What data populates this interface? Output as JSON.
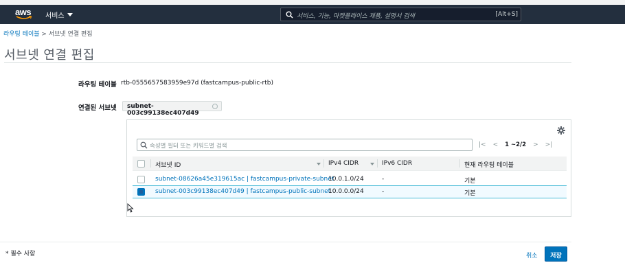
{
  "header": {
    "logo_text": "aws",
    "services_label": "서비스",
    "search_placeholder": "서비스, 기능, 마켓플레이스 제품, 설명서 검색",
    "search_shortcut": "[Alt+S]"
  },
  "breadcrumb": {
    "parent": "라우팅 테이블",
    "separator": ">",
    "current": "서브넷 연결 편집"
  },
  "page_title": "서브넷 연결 편집",
  "form": {
    "route_table_label": "라우팅 테이블",
    "route_table_value": "rtb-0555657583959e97d (fastcampus-public-rtb)",
    "associated_label": "연결된 서브넷",
    "associated_chip": "subnet-003c99138ec407d49"
  },
  "table": {
    "filter_placeholder": "속성별 필터 또는 키워드별 검색",
    "pagination": "1 ~2/2",
    "columns": [
      "서브넷 ID",
      "IPv4 CIDR",
      "IPv6 CIDR",
      "현재 라우팅 테이블"
    ],
    "rows": [
      {
        "subnet": "subnet-08626a45e319615ac | fastcampus-private-subnet",
        "ipv4": "10.0.1.0/24",
        "ipv6": "-",
        "route_table": "기본",
        "selected": false
      },
      {
        "subnet": "subnet-003c99138ec407d49 | fastcampus-public-subnet",
        "ipv4": "10.0.0.0/24",
        "ipv6": "-",
        "route_table": "기본",
        "selected": true
      }
    ]
  },
  "footer": {
    "required_note": "* 필수 사항",
    "cancel_label": "취소",
    "save_label": "저장"
  },
  "colors": {
    "topbar": "#232f3e",
    "link": "#0073bb",
    "primary_button": "#0073bb",
    "selected_row": "#f1faff"
  }
}
